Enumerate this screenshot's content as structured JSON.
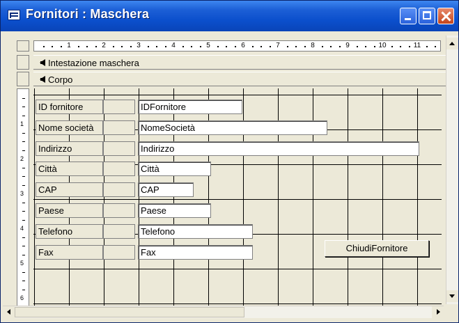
{
  "window": {
    "title": "Fornitori : Maschera"
  },
  "ruler": {
    "horizontal_numbers": [
      "1",
      "2",
      "3",
      "4",
      "5",
      "6",
      "7",
      "8",
      "9",
      "10",
      "11"
    ],
    "vertical_numbers": [
      "1",
      "2",
      "3",
      "4",
      "5",
      "6"
    ]
  },
  "sections": {
    "header_label": "Intestazione maschera",
    "body_label": "Corpo"
  },
  "fields": [
    {
      "label": "ID fornitore",
      "value": "IDFornitore"
    },
    {
      "label": "Nome società",
      "value": "NomeSocietà"
    },
    {
      "label": "Indirizzo",
      "value": "Indirizzo"
    },
    {
      "label": "Città",
      "value": "Città"
    },
    {
      "label": "CAP",
      "value": "CAP"
    },
    {
      "label": "Paese",
      "value": "Paese"
    },
    {
      "label": "Telefono",
      "value": "Telefono"
    },
    {
      "label": "Fax",
      "value": "Fax"
    }
  ],
  "command_button": {
    "label": "ChiudiFornitore"
  },
  "colors": {
    "titlebar": "#0b4fcc",
    "designer_bg": "#ece9d8",
    "grid_line": "#000000"
  }
}
